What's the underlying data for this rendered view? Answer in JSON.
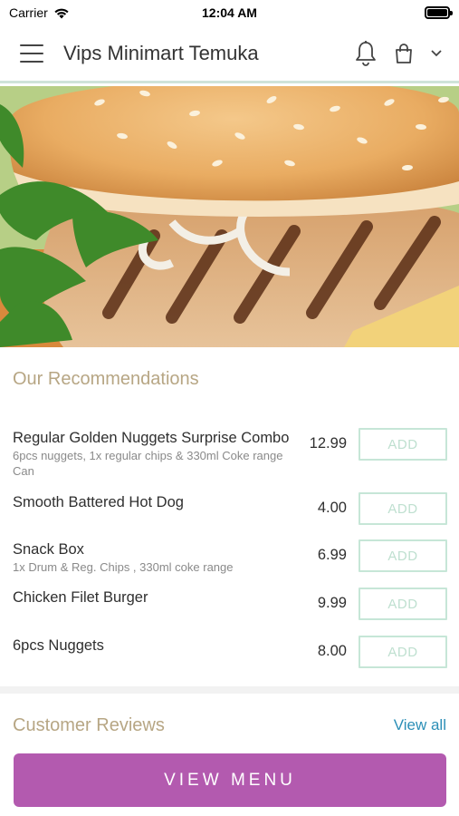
{
  "status_bar": {
    "carrier": "Carrier",
    "time": "12:04 AM",
    "battery_level": 1.0
  },
  "header": {
    "title": "Vips Minimart Temuka"
  },
  "recommendations": {
    "title": "Our Recommendations",
    "add_label": "ADD",
    "items": [
      {
        "name": "Regular Golden Nuggets Surprise Combo",
        "description": "6pcs nuggets, 1x regular chips & 330ml Coke range Can",
        "price": "12.99"
      },
      {
        "name": "Smooth Battered Hot Dog",
        "description": "",
        "price": "4.00"
      },
      {
        "name": "Snack Box",
        "description": "1x Drum & Reg. Chips , 330ml coke range",
        "price": "6.99"
      },
      {
        "name": "Chicken Filet Burger",
        "description": "",
        "price": "9.99"
      },
      {
        "name": "6pcs Nuggets",
        "description": "",
        "price": "8.00"
      }
    ]
  },
  "reviews": {
    "title": "Customer Reviews",
    "view_all": "View all"
  },
  "footer": {
    "view_menu": "VIEW MENU"
  },
  "colors": {
    "accent": "#b35aaf",
    "link": "#2c8fb7",
    "section_title": "#b7a684",
    "add_border": "#c6e6d7"
  },
  "icons": {
    "menu": "hamburger-icon",
    "notifications": "bell-icon",
    "cart": "shopping-bag-icon",
    "dropdown": "chevron-down-icon"
  }
}
